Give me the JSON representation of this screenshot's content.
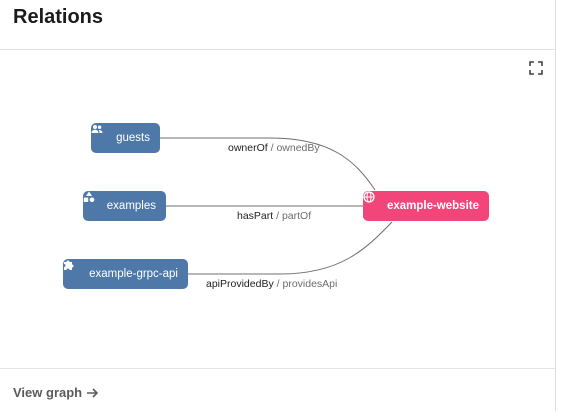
{
  "card": {
    "title": "Relations",
    "footer_link": "View graph"
  },
  "graph": {
    "source_nodes": [
      {
        "label": "guests",
        "icon": "group-icon"
      },
      {
        "label": "examples",
        "icon": "shapes-icon"
      },
      {
        "label": "example-grpc-api",
        "icon": "puzzle-icon"
      }
    ],
    "target_node": {
      "label": "example-website",
      "icon": "web-icon"
    },
    "edges": [
      {
        "relation": "ownerOf",
        "separator": "/",
        "reverse": "ownedBy"
      },
      {
        "relation": "hasPart",
        "separator": "/",
        "reverse": "partOf"
      },
      {
        "relation": "apiProvidedBy",
        "separator": "/",
        "reverse": "providesApi"
      }
    ]
  },
  "colors": {
    "node_blue": "#4e78a8",
    "node_pink": "#f2457a",
    "edge": "#6f6f6f"
  }
}
